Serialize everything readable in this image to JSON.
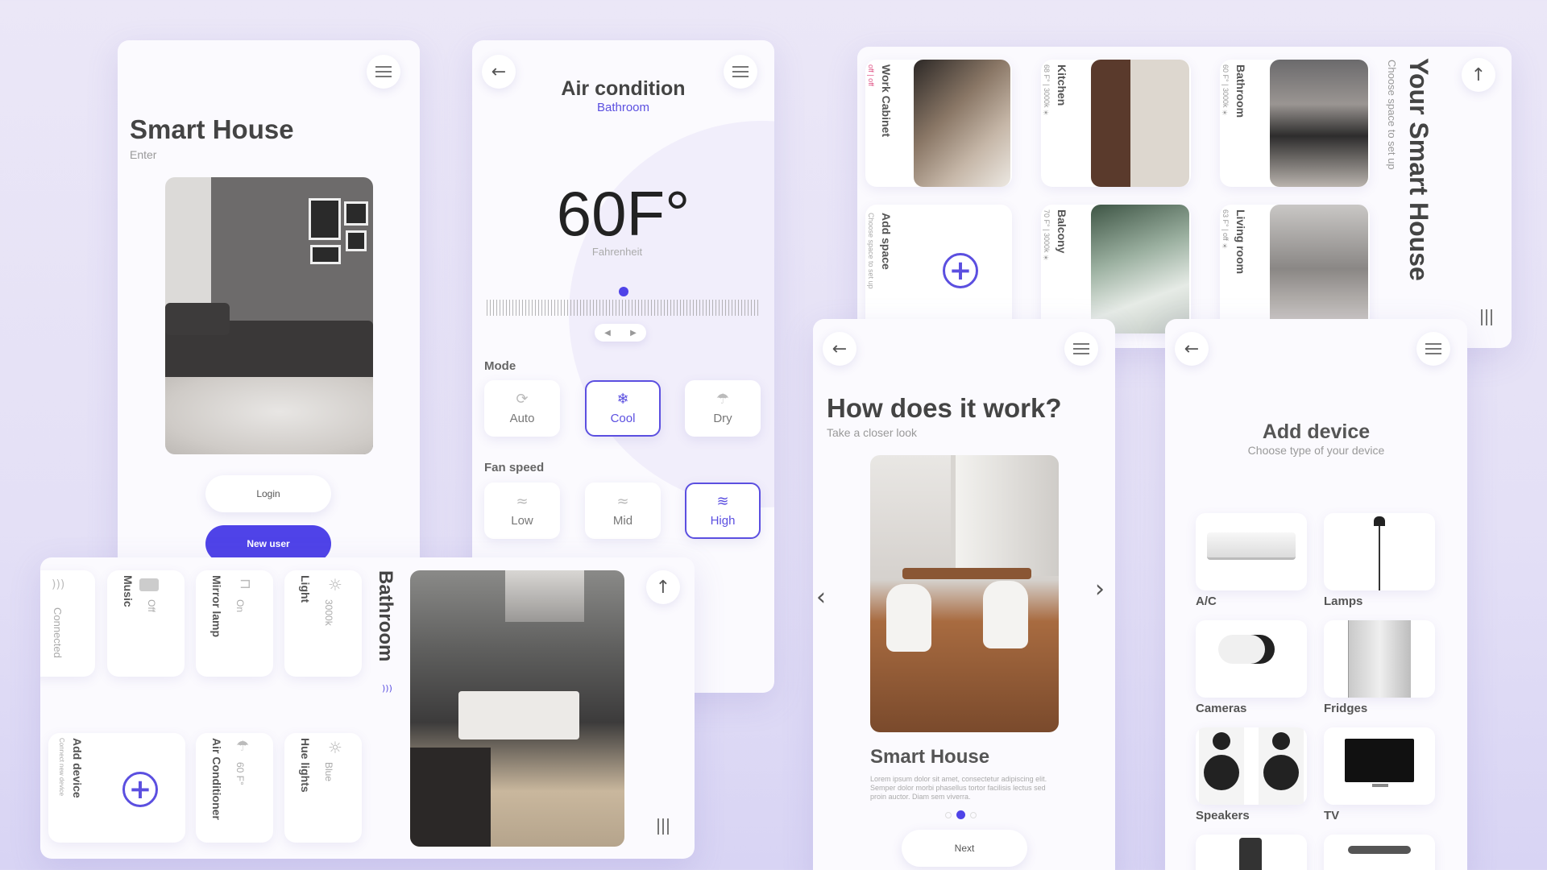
{
  "login_screen": {
    "title": "Smart House",
    "subtitle": "Enter",
    "login_button": "Login",
    "new_user_button": "New user",
    "menu_icon": "hamburger-icon"
  },
  "ac_screen": {
    "title": "Air condition",
    "room": "Bathroom",
    "temperature": "60F°",
    "unit_label": "Fahrenheit",
    "mode_label": "Mode",
    "modes": [
      {
        "label": "Auto",
        "icon": "auto-icon",
        "selected": false
      },
      {
        "label": "Cool",
        "icon": "snowflake-icon",
        "selected": true
      },
      {
        "label": "Dry",
        "icon": "drop-icon",
        "selected": false
      }
    ],
    "fan_label": "Fan speed",
    "fans": [
      {
        "label": "Low",
        "icon": "fan-low-icon",
        "selected": false
      },
      {
        "label": "Mid",
        "icon": "fan-mid-icon",
        "selected": false
      },
      {
        "label": "High",
        "icon": "fan-high-icon",
        "selected": true
      }
    ],
    "accent": "#5b4fe0"
  },
  "spaces_screen": {
    "title": "Your Smart House",
    "subtitle": "Choose space to set up",
    "spaces": [
      {
        "name": "Bathroom",
        "info": "60 F° | 3000k ☀"
      },
      {
        "name": "Kitchen",
        "info": "68 F° | 3000k ☀"
      },
      {
        "name": "Work Cabinet",
        "info": "off | off"
      },
      {
        "name": "Living room",
        "info": "63 F° | off ☀"
      },
      {
        "name": "Balcony",
        "info": "70 F° | 3000k ☀"
      }
    ],
    "add_space": {
      "title": "Add space",
      "hint": "Choose space to set up"
    }
  },
  "bathroom_screen": {
    "title": "Bathroom",
    "devices": [
      {
        "name": "Light",
        "status": "3000k",
        "icon": "sun-icon"
      },
      {
        "name": "Mirror lamp",
        "status": "On",
        "icon": "lamp-icon"
      },
      {
        "name": "Music",
        "status": "Off",
        "icon": "speaker-icon"
      },
      {
        "name": "Connected",
        "status": "",
        "icon": "wifi-icon"
      },
      {
        "name": "Hue lights",
        "status": "Blue",
        "icon": "sun-icon"
      },
      {
        "name": "Air Conditioner",
        "status": "60 F°",
        "icon": "ac-icon"
      },
      {
        "name": "Add device",
        "status": "Connect new device",
        "icon": "plus-icon"
      }
    ]
  },
  "onboarding_screen": {
    "title": "How does it work?",
    "subtitle": "Take a closer look",
    "card_title": "Smart House",
    "body": "Lorem ipsum dolor sit amet, consectetur adipiscing elit. Semper dolor morbi phasellus tortor facilisis lectus sed proin auctor. Diam sem viverra.",
    "next_button": "Next",
    "page_index": 1,
    "page_count": 3
  },
  "add_device_screen": {
    "title": "Add device",
    "subtitle": "Choose type of your device",
    "devices": [
      "A/C",
      "Lamps",
      "Cameras",
      "Fridges",
      "Speakers",
      "TV"
    ]
  }
}
